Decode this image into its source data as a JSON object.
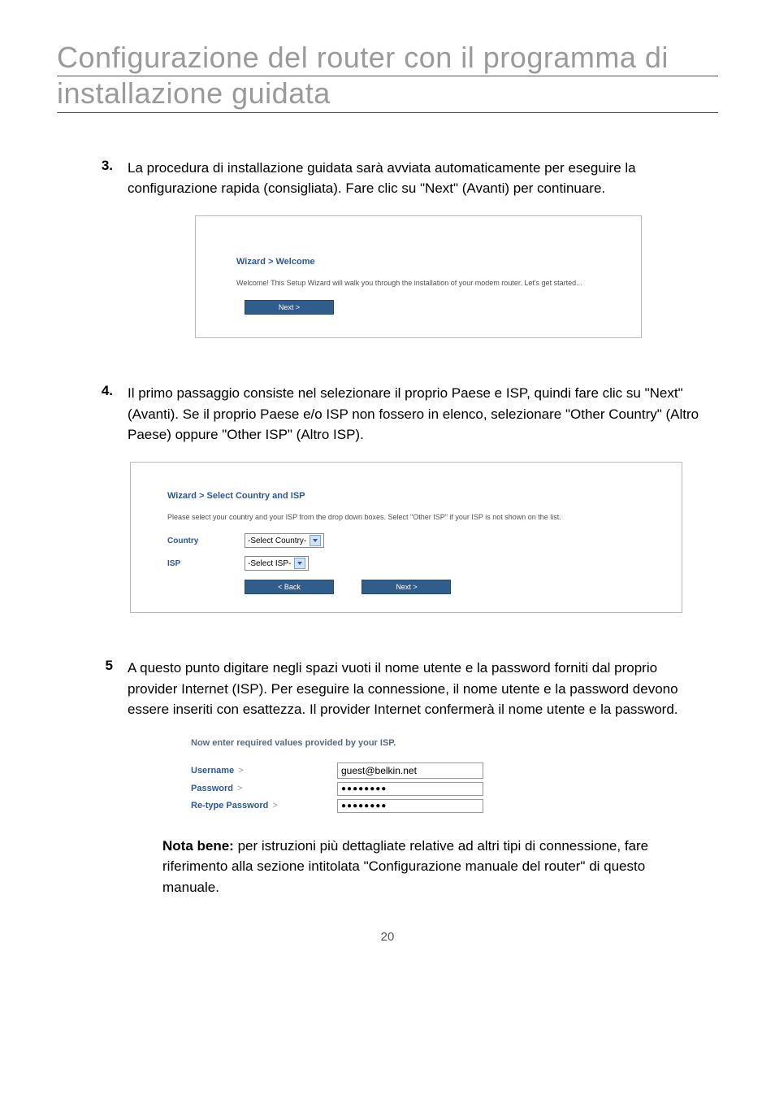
{
  "title_line1": "Configurazione del router con il programma di",
  "title_line2": "installazione guidata",
  "steps": {
    "s3": {
      "num": "3.",
      "text": "La procedura di installazione guidata sarà avviata automaticamente per eseguire la configurazione rapida (consigliata). Fare clic su \"Next\" (Avanti) per continuare."
    },
    "s4": {
      "num": "4.",
      "text": "Il primo passaggio consiste nel selezionare il proprio Paese e ISP, quindi fare clic su \"Next\" (Avanti). Se il proprio Paese e/o ISP non fossero in elenco, selezionare \"Other Country\" (Altro Paese) oppure \"Other ISP\" (Altro ISP)."
    },
    "s5": {
      "num": "5",
      "text": "A questo punto digitare negli spazi vuoti il nome utente e la password forniti dal proprio provider Internet (ISP). Per eseguire la connessione, il nome utente e la password devono essere inseriti con esattezza. Il provider Internet confermerà il nome utente e la password."
    }
  },
  "shot1": {
    "breadcrumb": "Wizard > Welcome",
    "desc": "Welcome! This Setup Wizard will walk you through the installation of your modem router. Let's get started...",
    "next": "Next >"
  },
  "shot2": {
    "breadcrumb": "Wizard > Select Country and ISP",
    "desc": "Please select your country and your ISP from the drop down boxes. Select \"Other ISP\" if your ISP is not shown on the list.",
    "country_label": "Country",
    "country_value": "-Select Country-",
    "isp_label": "ISP",
    "isp_value": "-Select ISP-",
    "back": "< Back",
    "next": "Next >"
  },
  "shot3": {
    "title": "Now enter required values provided by your ISP.",
    "username_label": "Username",
    "username_value": "guest@belkin.net",
    "password_label": "Password",
    "password_value": "●●●●●●●●",
    "retype_label": "Re-type Password",
    "retype_value": "●●●●●●●●",
    "gt": ">"
  },
  "note": {
    "bold": "Nota bene:",
    "rest": " per istruzioni più dettagliate relative ad altri tipi di connessione, fare riferimento alla sezione intitolata \"Configurazione manuale del router\" di questo manuale."
  },
  "page_number": "20"
}
